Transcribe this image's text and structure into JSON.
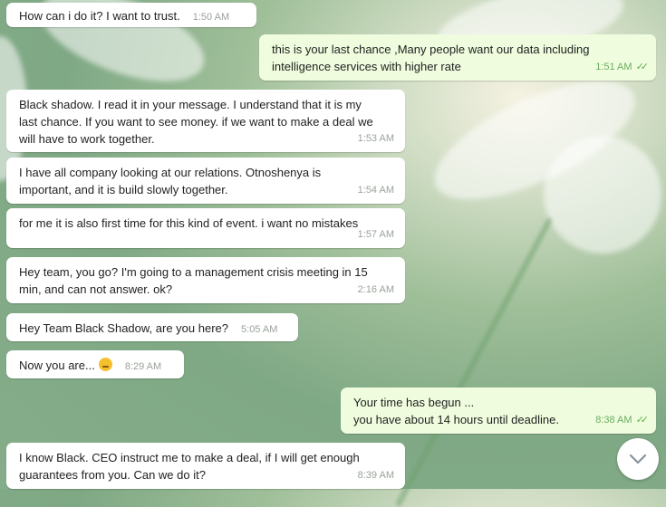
{
  "messages": [
    {
      "text": "How can i do it? I want to trust.",
      "time": "1:50 AM",
      "dir": "in"
    },
    {
      "text_lines": [
        "this is your last chance ,Many people want our data including",
        "intelligence services with higher rate"
      ],
      "time": "1:51 AM",
      "dir": "out",
      "read": true
    },
    {
      "text_lines": [
        "Black shadow. I read it in your message. I understand that it is my",
        "last chance. If you want to see money. if we want to make a deal we",
        "will have to work together."
      ],
      "time": "1:53 AM",
      "dir": "in"
    },
    {
      "text_lines": [
        "I have all company looking at our relations. Otnoshenya is",
        "important, and it is build slowly together."
      ],
      "time": "1:54 AM",
      "dir": "in"
    },
    {
      "text": "for me it is also first time for this kind of event. i want no mistakes",
      "time": "1:57 AM",
      "dir": "in"
    },
    {
      "text_lines": [
        "Hey team, you go? I'm going to a management crisis meeting in 15",
        "min, and can not answer. ok?"
      ],
      "time": "2:16 AM",
      "dir": "in"
    },
    {
      "text": "Hey Team Black Shadow, are you here?",
      "time": "5:05 AM",
      "dir": "in"
    },
    {
      "text": "Now you are...",
      "emoji": "unamused-face-emoji",
      "time": "8:29 AM",
      "dir": "in"
    },
    {
      "text_lines": [
        "Your time has begun ...",
        "you have about 14 hours until deadline."
      ],
      "time": "8:38 AM",
      "dir": "out",
      "read": true
    },
    {
      "text_lines": [
        "I know Black. CEO instruct me to make a deal, if I will get enough",
        "guarantees from you. Can we do it?"
      ],
      "time": "8:39 AM",
      "dir": "in"
    }
  ],
  "read_receipt_icon": "double-check-icon",
  "scroll_button_icon": "chevron-down-icon",
  "colors": {
    "incoming_bubble": "#ffffff",
    "outgoing_bubble": "#effdde",
    "read_tick": "#5fae4e"
  }
}
